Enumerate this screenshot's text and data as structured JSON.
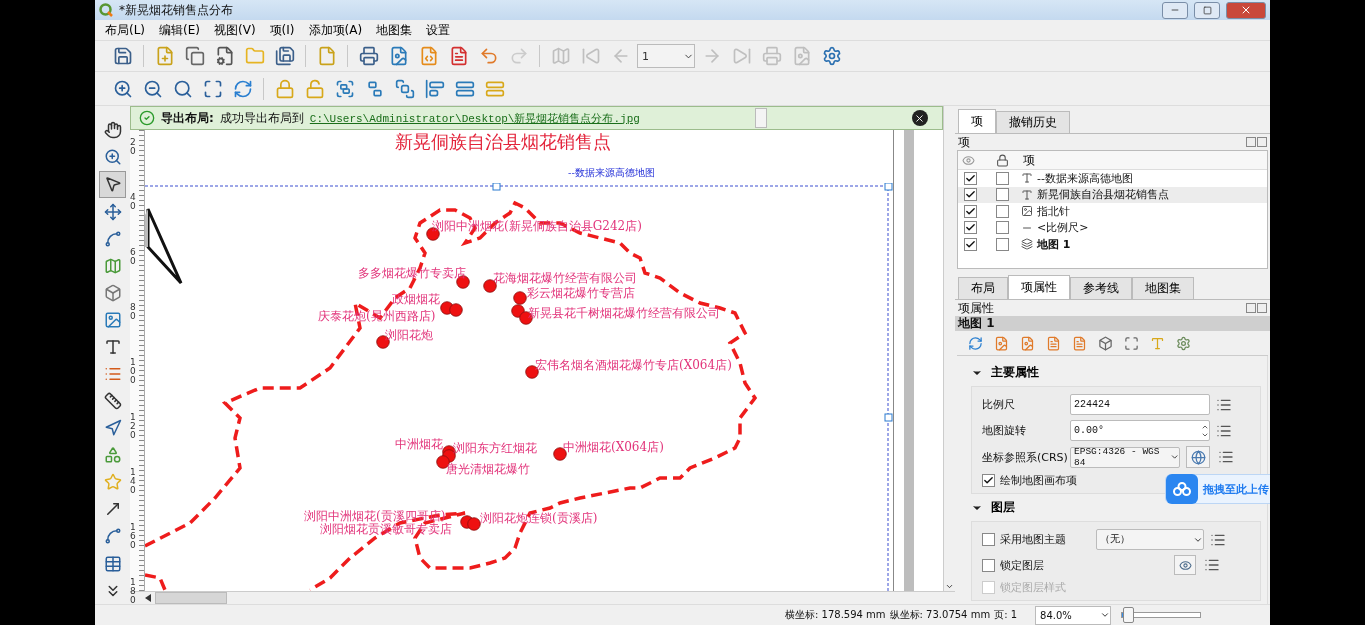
{
  "window": {
    "title": "*新晃烟花销售点分布"
  },
  "menu": [
    {
      "label": "布局(L)"
    },
    {
      "label": "编辑(E)"
    },
    {
      "label": "视图(V)"
    },
    {
      "label": "项(I)"
    },
    {
      "label": "添加项(A)"
    },
    {
      "label": "地图集"
    },
    {
      "label": "设置"
    }
  ],
  "toolbar_main": [
    {
      "kind": "save",
      "disabled": false
    },
    {
      "kind": "separator"
    },
    {
      "kind": "new-layout",
      "disabled": false
    },
    {
      "kind": "duplicate",
      "disabled": false
    },
    {
      "kind": "manager",
      "disabled": false
    },
    {
      "kind": "open",
      "disabled": false
    },
    {
      "kind": "save-as",
      "disabled": false
    },
    {
      "kind": "separator"
    },
    {
      "kind": "new-page",
      "disabled": false
    },
    {
      "kind": "separator"
    },
    {
      "kind": "print",
      "disabled": false
    },
    {
      "kind": "export-image",
      "disabled": false
    },
    {
      "kind": "export-svg",
      "disabled": false
    },
    {
      "kind": "export-pdf",
      "disabled": false
    },
    {
      "kind": "undo",
      "disabled": false
    },
    {
      "kind": "redo",
      "disabled": true
    },
    {
      "kind": "separator"
    },
    {
      "kind": "atlas-preview",
      "disabled": true
    },
    {
      "kind": "first",
      "disabled": true
    },
    {
      "kind": "prev",
      "disabled": true
    },
    {
      "kind": "page-field",
      "value": "1",
      "disabled": true
    },
    {
      "kind": "next",
      "disabled": true
    },
    {
      "kind": "last",
      "disabled": true
    },
    {
      "kind": "atlas-print",
      "disabled": true
    },
    {
      "kind": "atlas-export",
      "disabled": true
    },
    {
      "kind": "atlas-settings",
      "disabled": false
    }
  ],
  "toolbar_view": [
    {
      "kind": "zoom-in",
      "disabled": false
    },
    {
      "kind": "zoom-out",
      "disabled": false
    },
    {
      "kind": "zoom-actual",
      "disabled": false
    },
    {
      "kind": "zoom-full",
      "disabled": false
    },
    {
      "kind": "refresh",
      "disabled": false
    },
    {
      "kind": "separator"
    },
    {
      "kind": "lock",
      "disabled": false
    },
    {
      "kind": "unlock",
      "disabled": false
    },
    {
      "kind": "group",
      "disabled": false
    },
    {
      "kind": "ungroup",
      "disabled": false
    },
    {
      "kind": "raise",
      "disabled": false
    },
    {
      "kind": "align",
      "disabled": false
    },
    {
      "kind": "distribute",
      "disabled": false
    },
    {
      "kind": "resize",
      "disabled": false
    }
  ],
  "toolbox": [
    {
      "kind": "pan",
      "selected": false
    },
    {
      "kind": "zoom",
      "selected": false
    },
    {
      "kind": "select",
      "selected": true
    },
    {
      "kind": "move-content",
      "selected": false
    },
    {
      "kind": "edit-nodes",
      "selected": false
    },
    {
      "kind": "add-map",
      "selected": false
    },
    {
      "kind": "add-3d",
      "selected": false
    },
    {
      "kind": "add-picture",
      "selected": false
    },
    {
      "kind": "add-label",
      "selected": false
    },
    {
      "kind": "add-legend",
      "selected": false
    },
    {
      "kind": "add-scalebar",
      "selected": false
    },
    {
      "kind": "add-north-arrow",
      "selected": false
    },
    {
      "kind": "add-shape",
      "selected": false
    },
    {
      "kind": "add-marker",
      "selected": false
    },
    {
      "kind": "add-arrow",
      "selected": false
    },
    {
      "kind": "add-node",
      "selected": false
    },
    {
      "kind": "add-table",
      "selected": false
    },
    {
      "kind": "more",
      "selected": false
    }
  ],
  "message": {
    "title": "导出布局:",
    "text": "成功导出布局到",
    "link": "C:\\Users\\Administrator\\Desktop\\新晃烟花销售点分布.jpg"
  },
  "ruler": {
    "ticks": [
      "20",
      "40",
      "60",
      "80",
      "100",
      "120",
      "140",
      "160",
      "180"
    ]
  },
  "layout": {
    "title": "新晃侗族自治县烟花销售点",
    "subtitle": "--数据来源高德地图",
    "labels": [
      "浏阳中洲烟花(新晃侗族自治县G242店)",
      "多多烟花爆竹专卖店",
      "花海烟花爆竹经营有限公司",
      "彩云烟花爆竹专营店",
      "政烟烟花",
      "庆泰花炮(晃州西路店)",
      "新晃县花千树烟花爆竹经营有限公司",
      "浏阳花炮",
      "宏伟名烟名酒烟花爆竹专店(X064店)",
      "中洲烟花",
      "浏阳东方红烟花",
      "中洲烟花(X064店)",
      "唐光清烟花爆竹",
      "浏阳中洲烟花(贡溪四哥店)",
      "浏阳花炮连锁(贡溪店)",
      "浏阳烟花贡溪敏哥专卖店"
    ]
  },
  "items_panel": {
    "tabs": [
      {
        "label": "项",
        "selected": true
      },
      {
        "label": "撤销历史",
        "selected": false
      }
    ],
    "title": "项",
    "column": "项",
    "rows": [
      {
        "name": "--数据来源高德地图",
        "kind": "label",
        "visible": true,
        "locked": false,
        "selected": false,
        "current": false
      },
      {
        "name": "新晃侗族自治县烟花销售点",
        "kind": "label",
        "visible": true,
        "locked": false,
        "selected": true,
        "current": false
      },
      {
        "name": "指北针",
        "kind": "picture",
        "visible": true,
        "locked": false,
        "selected": false,
        "current": false
      },
      {
        "name": "<比例尺>",
        "kind": "scalebar",
        "visible": true,
        "locked": false,
        "selected": false,
        "current": false
      },
      {
        "name": "地图 1",
        "kind": "map",
        "visible": true,
        "locked": false,
        "selected": false,
        "current": true
      }
    ]
  },
  "properties_panel": {
    "tabs": [
      {
        "label": "布局",
        "selected": false
      },
      {
        "label": "项属性",
        "selected": true
      },
      {
        "label": "参考线",
        "selected": false
      },
      {
        "label": "地图集",
        "selected": false
      }
    ],
    "title": "项属性",
    "item": "地图 1",
    "main_section": {
      "title": "主要属性",
      "expanded": true,
      "scale": {
        "label": "比例尺",
        "value": "224424"
      },
      "rotation": {
        "label": "地图旋转",
        "value": "0.00°"
      },
      "crs": {
        "label": "坐标参照系(CRS)",
        "value": "EPSG:4326 - WGS 84"
      },
      "draw_items": {
        "label": "绘制地图画布项",
        "checked": true
      }
    },
    "layers_section": {
      "title": "图层",
      "expanded": true,
      "theme": {
        "label": "采用地图主题",
        "checked": false,
        "value": "（无）"
      },
      "lock_layers": {
        "label": "锁定图层",
        "checked": false
      },
      "lock_styles": {
        "label": "锁定图层样式",
        "checked": false,
        "disabled": true
      }
    }
  },
  "upload_overlay": {
    "label": "拖拽至此上传"
  },
  "status_bar": {
    "x": "横坐标: 178.594 mm",
    "y": "纵坐标: 73.0754 mm",
    "page": "页: 1",
    "zoom": "84.0%",
    "zoom_slider": {
      "level": 0.03
    }
  }
}
